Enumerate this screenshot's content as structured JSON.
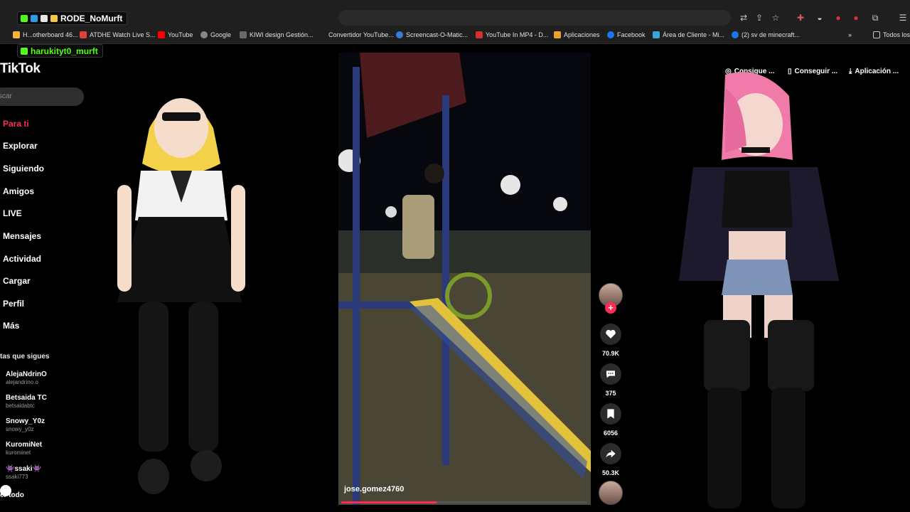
{
  "overlay": {
    "streamer_tag": "RODE_NoMurft",
    "viewer_tag": "harukityt0_murft"
  },
  "bookmarks": [
    {
      "label": "H...otherboard 46...",
      "color": "#f2b53a"
    },
    {
      "label": "ATDHE Watch Live S...",
      "color": "#d9443d"
    },
    {
      "label": "YouTube",
      "color": "#ff0000"
    },
    {
      "label": "Google",
      "color": "#888888"
    },
    {
      "label": "KIWI design Gestión...",
      "color": "#6a6a6a"
    },
    {
      "label": "Convertidor YouTube...",
      "color": "#2c2c2c"
    },
    {
      "label": "Screencast-O-Matic...",
      "color": "#3a7bd5"
    },
    {
      "label": "YouTube In MP4 - D...",
      "color": "#d62d2d"
    },
    {
      "label": "Aplicaciones",
      "color": "#e8a628"
    },
    {
      "label": "Facebook",
      "color": "#1877f2"
    },
    {
      "label": "Área de Cliente - Mi...",
      "color": "#3aa6d8"
    },
    {
      "label": "(2) sv de minecraft...",
      "color": "#1877f2"
    },
    {
      "label": "Todos los",
      "color": "#c8c8c8"
    }
  ],
  "tiktok": {
    "logo": "TikTok",
    "search_placeholder": "scar",
    "nav": [
      "Para ti",
      "Explorar",
      "Siguiendo",
      "Amigos",
      "LIVE",
      "Mensajes",
      "Actividad",
      "Cargar",
      "Perfil",
      "Más"
    ],
    "following_title": "tas que sigues",
    "accounts": [
      {
        "name": "AlejaNdrinO",
        "handle": "alejandrino.o"
      },
      {
        "name": "Betsaida TC",
        "handle": "betsaidabtc"
      },
      {
        "name": "Snowy_Y0z",
        "handle": "snowy_y0z"
      },
      {
        "name": "KuromiNet",
        "handle": "kurominet"
      },
      {
        "name": "👾ssaki👾",
        "handle": "ssaki773"
      }
    ],
    "see_all": "er todo"
  },
  "video": {
    "username": "jose.gomez4760",
    "progress": 0.39,
    "likes": "70.9K",
    "comments": "375",
    "saves": "6056",
    "shares": "50.3K"
  },
  "right_buttons": {
    "coins": "Consigue ...",
    "get": "Conseguir ...",
    "app": "Aplicación ..."
  }
}
